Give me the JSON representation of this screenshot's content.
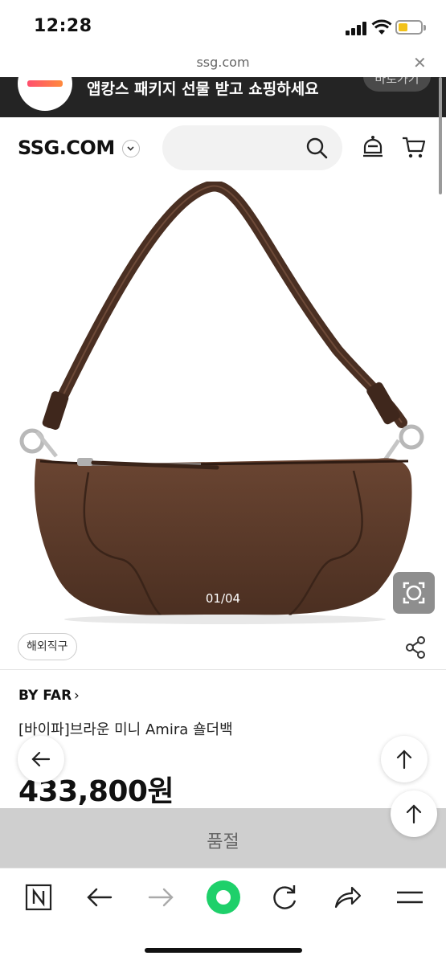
{
  "status_bar": {
    "time": "12:28"
  },
  "browser": {
    "url": "ssg.com",
    "close_label": "✕"
  },
  "app_banner": {
    "text": "앱캉스 패키지 선물 받고 쇼핑하세요",
    "button_label": "바로가기"
  },
  "header": {
    "logo": "SSG.COM",
    "search_placeholder": ""
  },
  "product": {
    "image_counter": "01/04",
    "tag": "해외직구",
    "brand": "BY FAR",
    "brand_chevron": "›",
    "name": "[바이파]브라운 미니 Amira 숄더백",
    "price": "433,800원",
    "colors": {
      "leather": "#5a3a2a",
      "leather_dark": "#3c2418",
      "strap": "#4a2f22"
    }
  },
  "soldout": {
    "label": "품절"
  },
  "toolbar": {
    "items": [
      "n-icon",
      "back-arrow-icon",
      "forward-arrow-icon",
      "whale-icon",
      "reload-icon",
      "share-icon",
      "menu-icon"
    ]
  },
  "colors": {
    "banner_bg": "#242424",
    "soldout_bg": "#cfcfcf",
    "accent_green": "#1ed06a"
  }
}
